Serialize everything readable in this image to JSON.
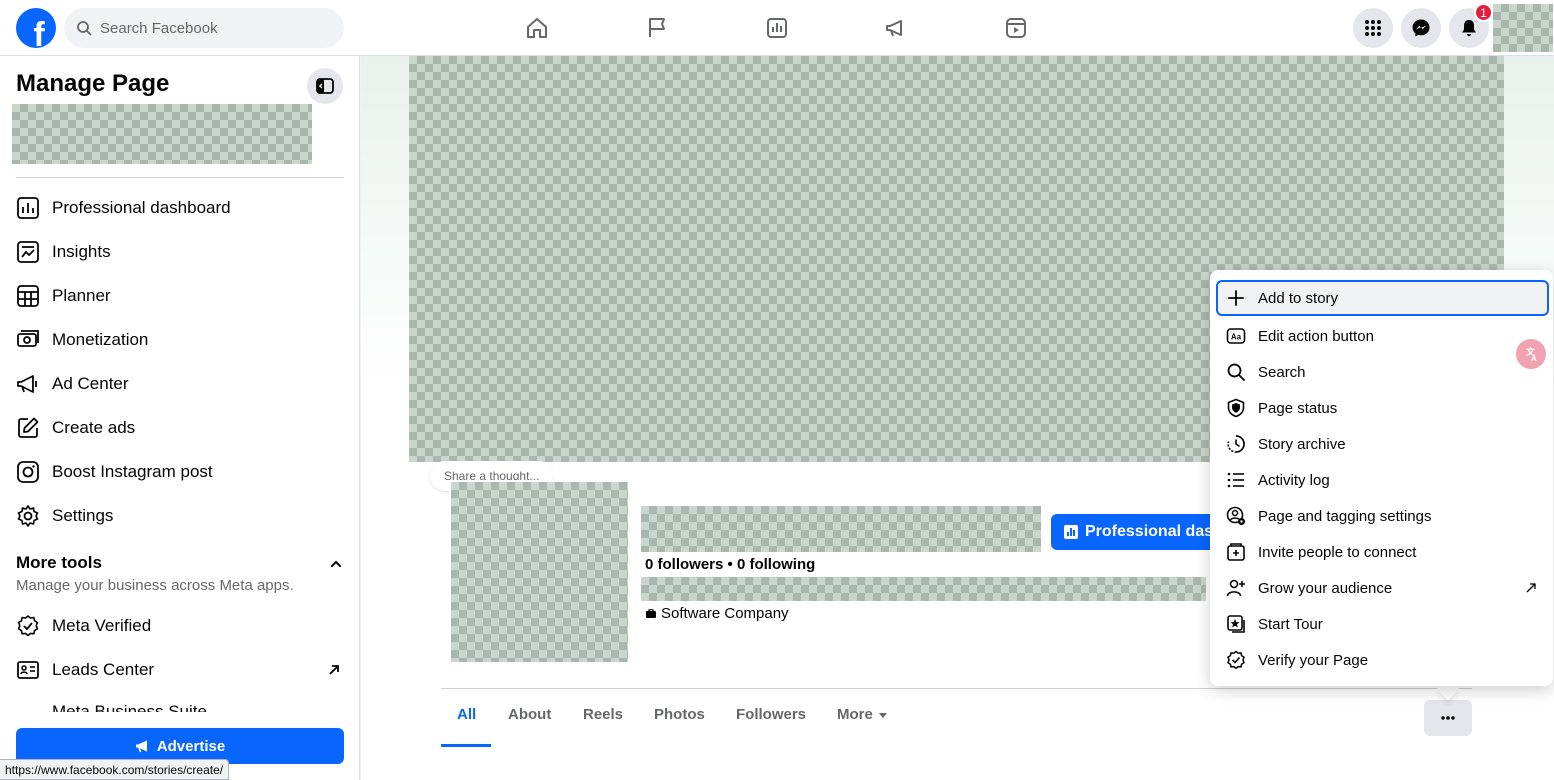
{
  "topbar": {
    "logo_letter": "f",
    "search_placeholder": "Search Facebook",
    "nav_icons": [
      "home-icon",
      "flag-icon",
      "dashboard-icon",
      "megaphone-icon",
      "reels-icon"
    ],
    "notifications_count": "1"
  },
  "sidebar": {
    "title": "Manage Page",
    "items": [
      {
        "label": "Professional dashboard",
        "icon": "dashboard-icon"
      },
      {
        "label": "Insights",
        "icon": "insights-icon"
      },
      {
        "label": "Planner",
        "icon": "planner-icon"
      },
      {
        "label": "Monetization",
        "icon": "monetization-icon"
      },
      {
        "label": "Ad Center",
        "icon": "megaphone-icon"
      },
      {
        "label": "Create ads",
        "icon": "pencil-icon"
      },
      {
        "label": "Boost Instagram post",
        "icon": "instagram-icon"
      },
      {
        "label": "Settings",
        "icon": "gear-icon"
      }
    ],
    "more_tools": {
      "title": "More tools",
      "subtitle": "Manage your business across Meta apps.",
      "items": [
        {
          "label": "Meta Verified",
          "icon": "verified-icon"
        },
        {
          "label": "Leads Center",
          "icon": "leads-icon"
        },
        {
          "label": "Meta Business Suite",
          "icon": "business-suite-icon"
        }
      ]
    },
    "advertise_label": "Advertise"
  },
  "profile": {
    "share_thought": "Share a thought...",
    "followers": "0 followers • 0 following",
    "category": "Software Company",
    "pro_button": "Professional dashboard"
  },
  "tabs": [
    {
      "label": "All",
      "active": true
    },
    {
      "label": "About"
    },
    {
      "label": "Reels"
    },
    {
      "label": "Photos"
    },
    {
      "label": "Followers"
    },
    {
      "label": "More"
    }
  ],
  "dropdown": {
    "items": [
      {
        "label": "Add to story",
        "icon": "plus-icon",
        "focused": true
      },
      {
        "label": "Edit action button",
        "icon": "action-button-icon"
      },
      {
        "label": "Search",
        "icon": "search-icon"
      },
      {
        "label": "Page status",
        "icon": "shield-icon"
      },
      {
        "label": "Story archive",
        "icon": "clock-archive-icon"
      },
      {
        "label": "Activity log",
        "icon": "list-icon"
      },
      {
        "label": "Page and tagging settings",
        "icon": "tag-settings-icon"
      },
      {
        "label": "Invite people to connect",
        "icon": "invite-icon"
      },
      {
        "label": "Grow your audience",
        "icon": "grow-audience-icon",
        "external": true
      },
      {
        "label": "Start Tour",
        "icon": "tour-icon"
      },
      {
        "label": "Verify your Page",
        "icon": "verified-icon"
      }
    ]
  },
  "status_bar_url": "https://www.facebook.com/stories/create/",
  "colors": {
    "brand": "#0866ff",
    "badge": "#e41e3f"
  }
}
